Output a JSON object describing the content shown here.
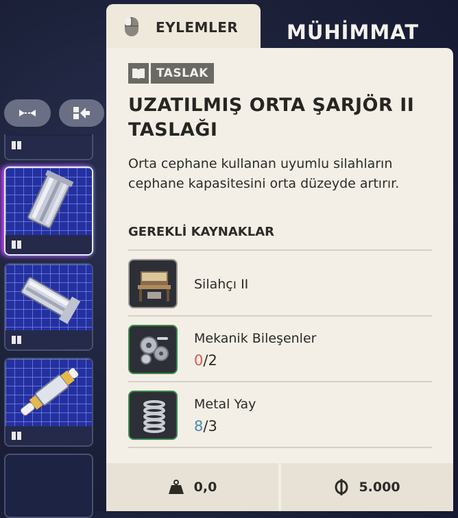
{
  "tab": {
    "label": "EYLEMLER"
  },
  "header": {
    "ammo_title": "MÜHİMMAT"
  },
  "card": {
    "badge": "TASLAK",
    "title": "UZATILMIŞ ORTA ŞARJÖR II TASLAĞI",
    "description": "Orta cephane kullanan uyumlu silahların cephane kapasitesini orta düzeyde artırır.",
    "requirements_heading": "GEREKLİ KAYNAKLAR",
    "resources": [
      {
        "name": "Silahçı II",
        "icon": "workbench-icon"
      },
      {
        "name": "Mekanik Bileşenler",
        "have": "0",
        "sep": "/",
        "need": "2",
        "icon": "gears-icon"
      },
      {
        "name": "Metal Yay",
        "have": "8",
        "sep": "/",
        "need": "3",
        "icon": "spring-icon"
      }
    ],
    "footer": {
      "weight": "0,0",
      "price": "5.000"
    }
  },
  "colors": {
    "card_bg": "#f3efe6",
    "insufficient": "#d65a4a",
    "sufficient": "#4a8ab0",
    "selected_glow": "#c040ff"
  }
}
